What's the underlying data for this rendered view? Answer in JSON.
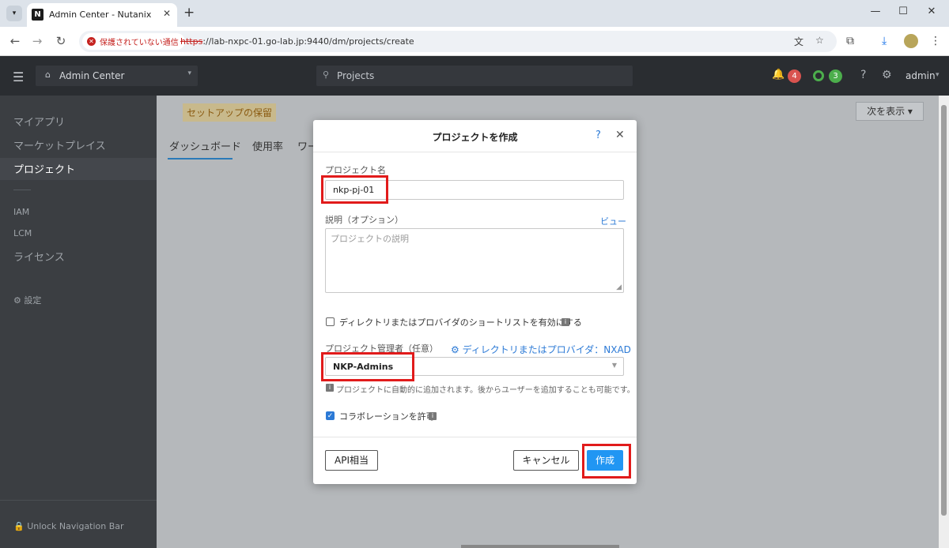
{
  "browser": {
    "tab_title": "Admin Center - Nutanix",
    "favicon_text": "N",
    "security_label": "保護されていない通信",
    "url_scheme": "https",
    "url_rest": "://lab-nxpc-01.go-lab.jp:9440/dm/projects/create"
  },
  "header": {
    "app_name": "Admin Center",
    "search_placeholder": "Projects",
    "alerts_count": "4",
    "tasks_count": "3",
    "user": "admin"
  },
  "sidebar": {
    "items": [
      "マイアプリ",
      "マーケットプレイス",
      "プロジェクト"
    ],
    "active_index": 2,
    "admin_items": [
      "IAM",
      "LCM",
      "ライセンス"
    ],
    "settings_label": "設定",
    "unlock_label": "Unlock Navigation Bar"
  },
  "page": {
    "setup_label": "セットアップの保留",
    "next_label": "次を表示",
    "tabs": [
      "ダッシュボード",
      "使用率",
      "ワー"
    ]
  },
  "modal": {
    "title": "プロジェクトを作成",
    "help": "?",
    "close": "✕",
    "name_label": "プロジェクト名",
    "name_value": "nkp-pj-01",
    "desc_label": "説明（オプション）",
    "desc_placeholder": "プロジェクトの説明",
    "preview_label": "ビュー",
    "shortlist_label": "ディレクトリまたはプロバイダのショートリストを有効にする",
    "shortlist_checked": false,
    "admin_label": "プロジェクト管理者（任意）",
    "directory_link": "ディレクトリまたはプロバイダ：NXAD",
    "admin_value": "NKP-Admins",
    "admin_hint": "プロジェクトに自動的に追加されます。後からユーザーを追加することも可能です。",
    "collab_label": "コラボレーションを許可",
    "collab_checked": true,
    "api_button": "API相当",
    "cancel_button": "キャンセル",
    "create_button": "作成"
  },
  "colors": {
    "accent": "#2196f3",
    "highlight": "#e11b1b",
    "alert": "#d9534f",
    "success": "#4cae4c"
  }
}
